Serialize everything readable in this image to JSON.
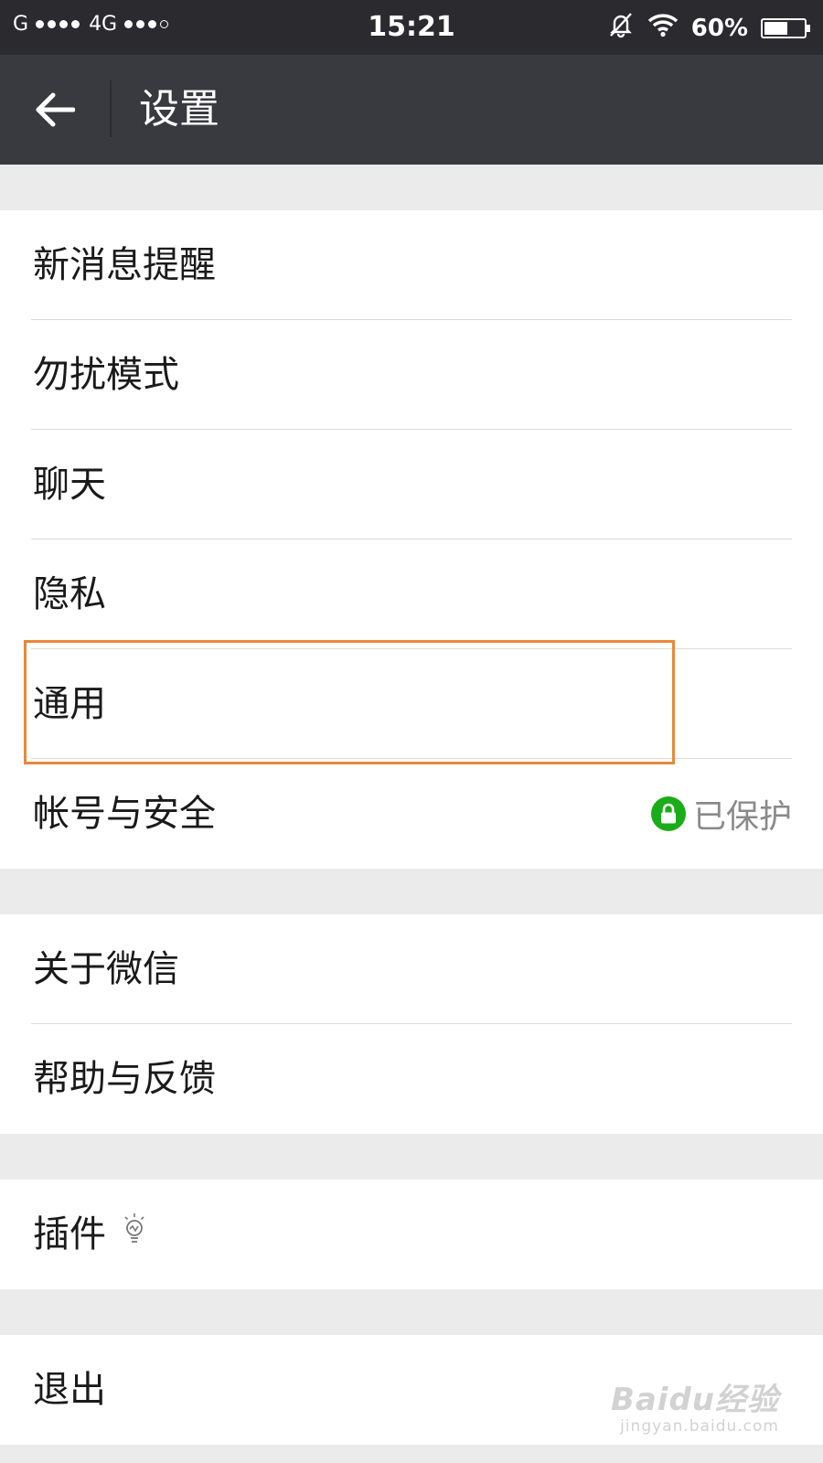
{
  "status_bar": {
    "carrier": "G",
    "network": "4G",
    "time": "15:21",
    "battery": "60%",
    "battery_level": 0.6
  },
  "nav": {
    "title": "设置"
  },
  "groups": {
    "g1": [
      {
        "label": "新消息提醒"
      },
      {
        "label": "勿扰模式"
      },
      {
        "label": "聊天"
      },
      {
        "label": "隐私"
      },
      {
        "label": "通用"
      },
      {
        "label": "帐号与安全",
        "value": "已保护"
      }
    ],
    "g2": [
      {
        "label": "关于微信"
      },
      {
        "label": "帮助与反馈"
      }
    ],
    "g3": [
      {
        "label": "插件"
      }
    ],
    "g4": [
      {
        "label": "退出"
      }
    ]
  },
  "colors": {
    "nav_bg": "#393a3f",
    "status_bg": "#2b2b2f",
    "page_bg": "#ebebeb",
    "lock_green": "#1aad19",
    "highlight": "#e8883a"
  },
  "watermark": {
    "top": "Baidu经验",
    "bottom": "jingyan.baidu.com"
  }
}
